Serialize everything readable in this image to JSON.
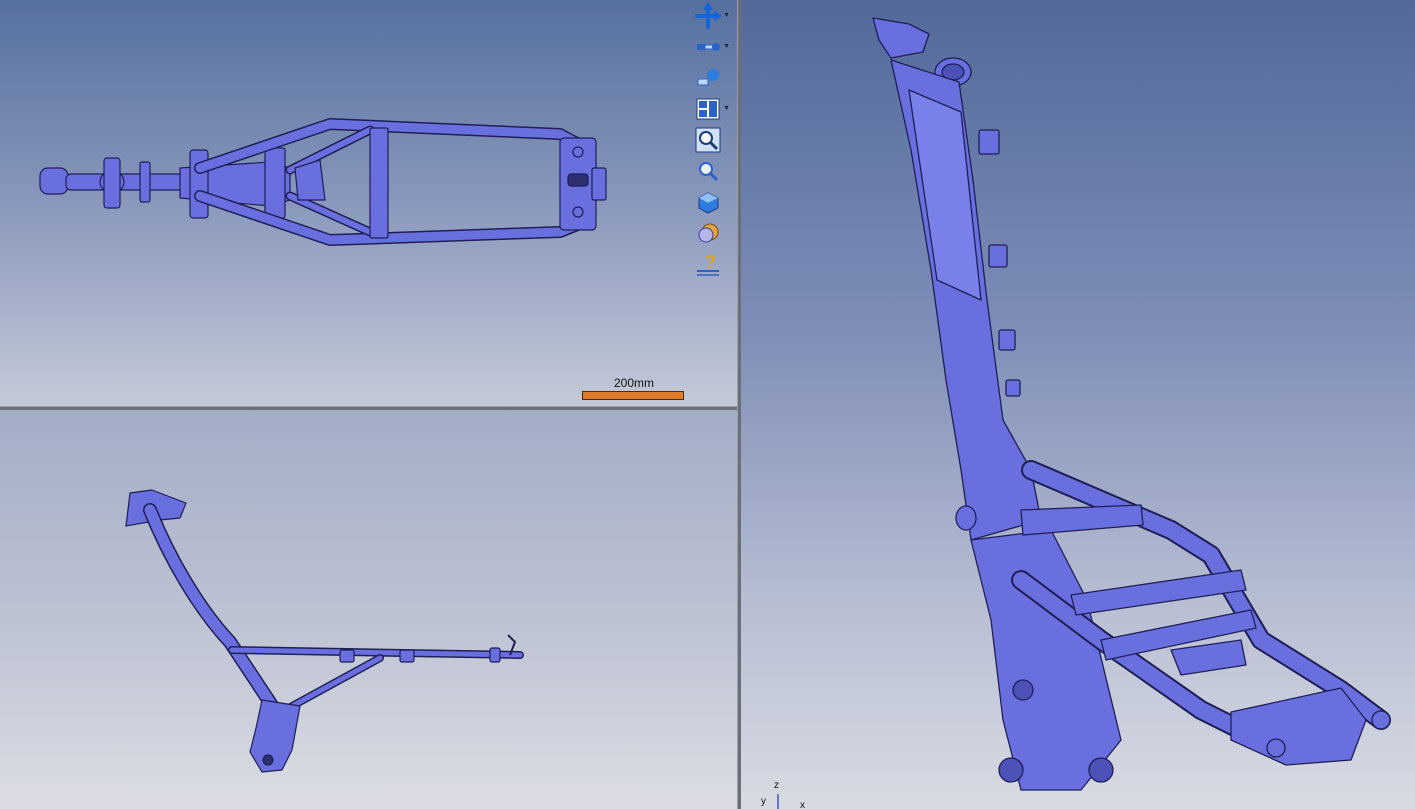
{
  "scale_bar": {
    "label": "200mm"
  },
  "axes": {
    "z": "z",
    "y": "y",
    "x": "x"
  },
  "toolbar": [
    {
      "name": "pan-icon",
      "has_dropdown": true
    },
    {
      "name": "rotate-icon",
      "has_dropdown": true
    },
    {
      "name": "walk-icon",
      "has_dropdown": false
    },
    {
      "name": "multi-view-icon",
      "has_dropdown": true
    },
    {
      "name": "zoom-area-icon",
      "has_dropdown": false
    },
    {
      "name": "zoom-icon",
      "has_dropdown": false
    },
    {
      "name": "view-cube-icon",
      "has_dropdown": false
    },
    {
      "name": "render-style-icon",
      "has_dropdown": false
    },
    {
      "name": "help-icon",
      "has_dropdown": false
    }
  ],
  "colors": {
    "model": "#6a6fe0",
    "model_edge": "#1e1f55",
    "scale_bar": "#e07b2b"
  }
}
